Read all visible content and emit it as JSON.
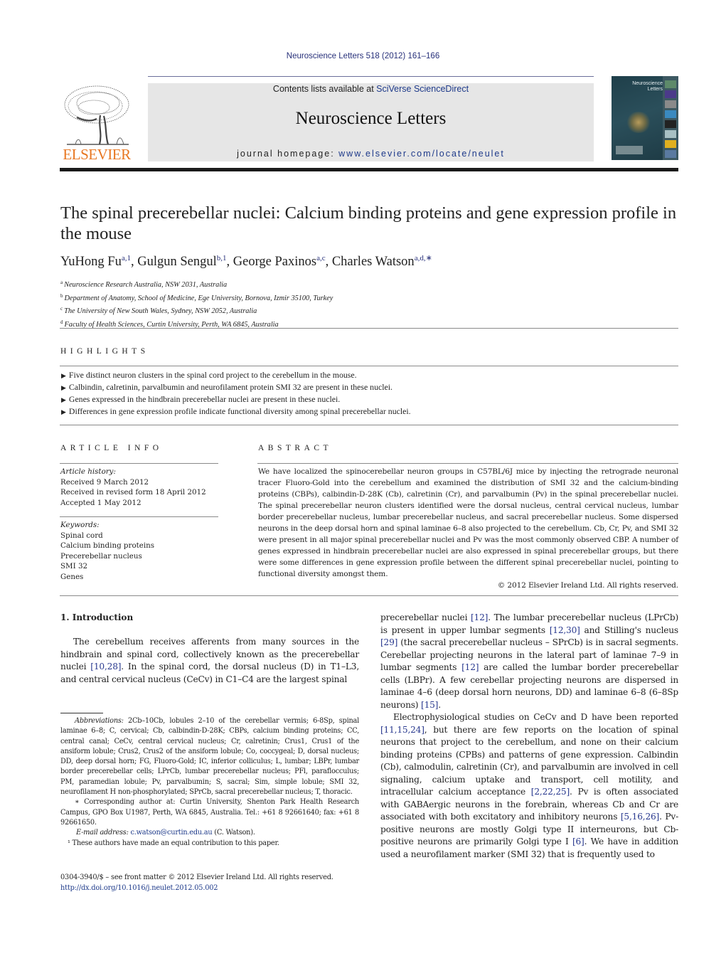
{
  "header": {
    "journal_ref": "Neuroscience Letters 518 (2012) 161–166",
    "contents_prefix": "Contents lists available at ",
    "contents_link": "SciVerse ScienceDirect",
    "journal_name": "Neuroscience Letters",
    "homepage_prefix": "journal homepage: ",
    "homepage_link": "www.elsevier.com/locate/neulet",
    "publisher_logo": "ELSEVIER",
    "cover_title": "Neuroscience Letters"
  },
  "colors": {
    "link": "#1e3a8a",
    "publisher_orange": "#e87722",
    "banner_gray": "#e6e6e6"
  },
  "article": {
    "title": "The spinal precerebellar nuclei: Calcium binding proteins and gene expression profile in the mouse",
    "authors": [
      {
        "name": "YuHong Fu",
        "sup": "a,1",
        "sep": ", "
      },
      {
        "name": "Gulgun Sengul",
        "sup": "b,1",
        "sep": ", "
      },
      {
        "name": "George Paxinos",
        "sup": "a,c",
        "sep": ", "
      },
      {
        "name": "Charles Watson",
        "sup": "a,d,∗",
        "sep": ""
      }
    ],
    "affiliations": [
      {
        "key": "a",
        "text": "Neuroscience Research Australia, NSW 2031, Australia"
      },
      {
        "key": "b",
        "text": "Department of Anatomy, School of Medicine, Ege University, Bornova, Izmir 35100, Turkey"
      },
      {
        "key": "c",
        "text": "The University of New South Wales, Sydney, NSW 2052, Australia"
      },
      {
        "key": "d",
        "text": "Faculty of Health Sciences, Curtin University, Perth, WA 6845, Australia"
      }
    ]
  },
  "highlights": {
    "heading": "HIGHLIGHTS",
    "bullet": "▶",
    "items": [
      "Five distinct neuron clusters in the spinal cord project to the cerebellum in the mouse.",
      "Calbindin, calretinin, parvalbumin and neurofilament protein SMI 32 are present in these nuclei.",
      "Genes expressed in the hindbrain precerebellar nuclei are present in these nuclei.",
      "Differences in gene expression profile indicate functional diversity among spinal precerebellar nuclei."
    ]
  },
  "article_info": {
    "heading": "ARTICLE INFO",
    "history_label": "Article history:",
    "history": [
      "Received 9 March 2012",
      "Received in revised form 18 April 2012",
      "Accepted 1 May 2012"
    ],
    "keywords_label": "Keywords:",
    "keywords": [
      "Spinal cord",
      "Calcium binding proteins",
      "Precerebellar nucleus",
      "SMI 32",
      "Genes"
    ]
  },
  "abstract": {
    "heading": "ABSTRACT",
    "text": "We have localized the spinocerebellar neuron groups in C57BL/6J mice by injecting the retrograde neuronal tracer Fluoro-Gold into the cerebellum and examined the distribution of SMI 32 and the calcium-binding proteins (CBPs), calbindin-D-28K (Cb), calretinin (Cr), and parvalbumin (Pv) in the spinal precerebellar nuclei. The spinal precerebellar neuron clusters identified were the dorsal nucleus, central cervical nucleus, lumbar border precerebellar nucleus, lumbar precerebellar nucleus, and sacral precerebellar nucleus. Some dispersed neurons in the deep dorsal horn and spinal laminae 6–8 also projected to the cerebellum. Cb, Cr, Pv, and SMI 32 were present in all major spinal precerebellar nuclei and Pv was the most commonly observed CBP. A number of genes expressed in hindbrain precerebellar nuclei are also expressed in spinal precerebellar groups, but there were some differences in gene expression profile between the different spinal precerebellar nuclei, pointing to functional diversity amongst them.",
    "copyright": "© 2012 Elsevier Ireland Ltd. All rights reserved."
  },
  "introduction": {
    "heading": "1.  Introduction",
    "left_col": {
      "p1_a": "The cerebellum receives afferents from many sources in the hindbrain and spinal cord, collectively known as the precerebellar nuclei ",
      "p1_ref1": "[10,28]",
      "p1_b": ". In the spinal cord, the dorsal nucleus (D) in T1–L3, and central cervical nucleus (CeCv) in C1–C4 are the largest spinal"
    },
    "right_col": {
      "p1_a": "precerebellar nuclei ",
      "p1_ref1": "[12]",
      "p1_b": ". The lumbar precerebellar nucleus (LPrCb) is present in upper lumbar segments ",
      "p1_ref2": "[12,30]",
      "p1_c": " and Stilling's nucleus ",
      "p1_ref3": "[29]",
      "p1_d": " (the sacral precerebellar nucleus – SPrCb) is in sacral segments. Cerebellar projecting neurons in the lateral part of laminae 7–9 in lumbar segments ",
      "p1_ref4": "[12]",
      "p1_e": " are called the lumbar border precerebellar cells (LBPr). A few cerebellar projecting neurons are dispersed in laminae 4–6 (deep dorsal horn neurons, DD) and laminae 6–8 (6–8Sp neurons) ",
      "p1_ref5": "[15]",
      "p1_f": ".",
      "p2_a": "Electrophysiological studies on CeCv and D have been reported ",
      "p2_ref1": "[11,15,24]",
      "p2_b": ", but there are few reports on the location of spinal neurons that project to the cerebellum, and none on their calcium binding proteins (CPBs) and patterns of gene expression. Calbindin (Cb), calmodulin, calretinin (Cr), and parvalbumin are involved in cell signaling, calcium uptake and transport, cell motility, and intracellular calcium acceptance ",
      "p2_ref2": "[2,22,25]",
      "p2_c": ". Pv is often associated with GABAergic neurons in the forebrain, whereas Cb and Cr are associated with both excitatory and inhibitory neurons ",
      "p2_ref3": "[5,16,26]",
      "p2_d": ". Pv-positive neurons are mostly Golgi type II interneurons, but Cb-positive neurons are primarily Golgi type I ",
      "p2_ref4": "[6]",
      "p2_e": ". We have in addition used a neurofilament marker (SMI 32) that is frequently used to"
    }
  },
  "footnotes": {
    "abbrev_label": "Abbreviations:",
    "abbrev_text": " 2Cb–10Cb, lobules 2–10 of the cerebellar vermis; 6-8Sp, spinal laminae 6–8; C, cervical; Cb, calbindin-D-28K; CBPs, calcium binding proteins; CC, central canal; CeCv, central cervical nucleus; Cr, calretinin; Crus1, Crus1 of the ansiform lobule; Crus2, Crus2 of the ansiform lobule; Co, coccygeal; D, dorsal nucleus; DD, deep dorsal horn; FG, Fluoro-Gold; IC, inferior colliculus; L, lumbar; LBPr, lumbar border precerebellar cells; LPrCb, lumbar precerebellar nucleus; PFl, paraflocculus; PM, paramedian lobule; Pv, parvalbumin; S, sacral; Sim, simple lobule; SMI 32, neurofilament H non-phosphorylated; SPrCb, sacral precerebellar nucleus; T, thoracic.",
    "corresponding": "∗ Corresponding author at: Curtin University, Shenton Park Health Research Campus, GPO Box U1987, Perth, WA 6845, Australia. Tel.: +61 8 92661640; fax: +61 8 92661650.",
    "email_label": "E-mail address:",
    "email": "c.watson@curtin.edu.au",
    "email_suffix": " (C. Watson).",
    "equal_contrib": "¹ These authors have made an equal contribution to this paper.",
    "front_matter": "0304-3940/$ – see front matter © 2012 Elsevier Ireland Ltd. All rights reserved.",
    "doi": "http://dx.doi.org/10.1016/j.neulet.2012.05.002"
  }
}
